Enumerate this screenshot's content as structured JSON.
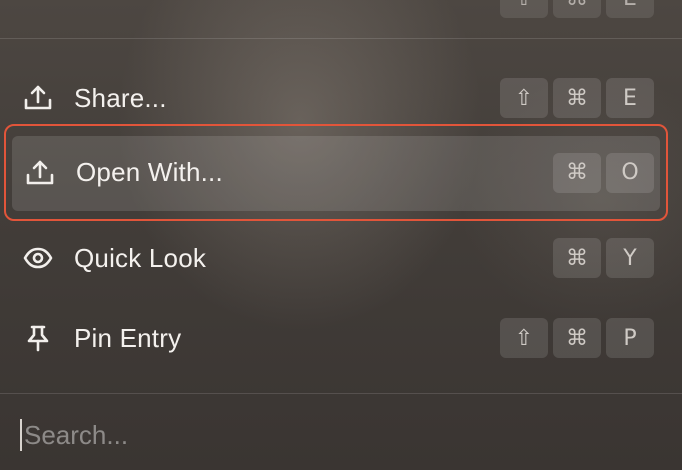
{
  "menu": {
    "top_keys": [
      "⇧",
      "⌘",
      "E"
    ],
    "items": [
      {
        "label": "Share...",
        "icon": "share-icon",
        "shortcut": [
          "⇧",
          "⌘",
          "E"
        ],
        "selected": false
      },
      {
        "label": "Open With...",
        "icon": "open-with-icon",
        "shortcut": [
          "⌘",
          "O"
        ],
        "selected": true
      },
      {
        "label": "Quick Look",
        "icon": "eye-icon",
        "shortcut": [
          "⌘",
          "Y"
        ],
        "selected": false
      },
      {
        "label": "Pin Entry",
        "icon": "pin-icon",
        "shortcut": [
          "⇧",
          "⌘",
          "P"
        ],
        "selected": false
      }
    ],
    "highlight_color": "#e2553a"
  },
  "search": {
    "placeholder": "Search...",
    "value": ""
  }
}
